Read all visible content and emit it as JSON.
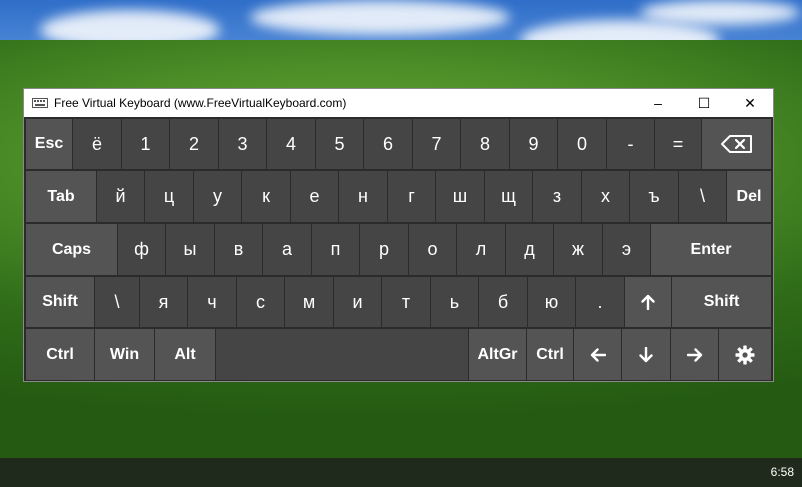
{
  "window": {
    "title": "Free Virtual Keyboard (www.FreeVirtualKeyboard.com)",
    "controls": {
      "minimize": "–",
      "maximize": "☐",
      "close": "✕"
    }
  },
  "taskbar": {
    "clock": "6:58"
  },
  "keyboard": {
    "row1": [
      "Esc",
      "ё",
      "1",
      "2",
      "3",
      "4",
      "5",
      "6",
      "7",
      "8",
      "9",
      "0",
      "-",
      "=",
      "backspace"
    ],
    "row2": [
      "Tab",
      "й",
      "ц",
      "у",
      "к",
      "е",
      "н",
      "г",
      "ш",
      "щ",
      "з",
      "х",
      "ъ",
      "\\",
      "Del"
    ],
    "row3": [
      "Caps",
      "ф",
      "ы",
      "в",
      "а",
      "п",
      "р",
      "о",
      "л",
      "д",
      "ж",
      "э",
      "Enter"
    ],
    "row4": [
      "Shift",
      "\\",
      "я",
      "ч",
      "с",
      "м",
      "и",
      "т",
      "ь",
      "б",
      "ю",
      ".",
      "up-arrow",
      "Shift"
    ],
    "row5": [
      "Ctrl",
      "Win",
      "Alt",
      "space",
      "AltGr",
      "Ctrl",
      "left-arrow",
      "down-arrow",
      "right-arrow",
      "settings"
    ]
  }
}
